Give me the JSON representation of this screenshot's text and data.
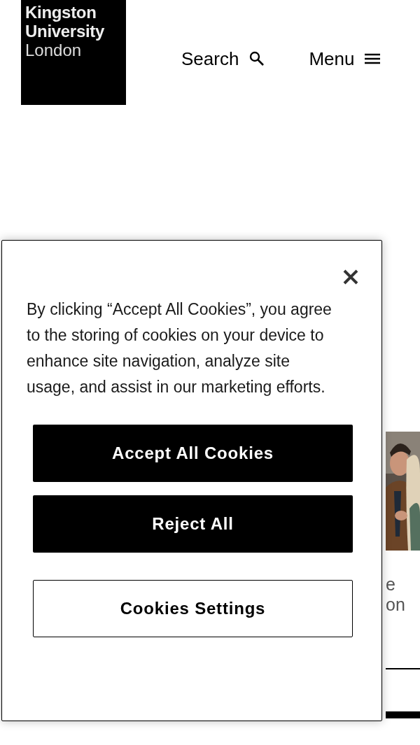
{
  "header": {
    "logo": [
      {
        "text": "Kingston",
        "kind": "bold"
      },
      {
        "text": "University",
        "kind": "bold"
      },
      {
        "text": "London",
        "kind": "light"
      }
    ],
    "search": {
      "label": "Search"
    },
    "menu": {
      "label": "Menu"
    }
  },
  "background": {
    "picture": {
      "kind": "picture"
    },
    "text": [
      "e",
      "on"
    ]
  },
  "cookie_dialog": {
    "message": "By clicking “Accept All Cookies”, you agree to the storing of cookies on your device to enhance site navigation, analyze site usage, and assist in our marketing efforts.",
    "buttons": [
      {
        "label": "Accept All Cookies",
        "kind": "primary"
      },
      {
        "label": "Reject All",
        "kind": "primary"
      },
      {
        "label": "Cookies Settings",
        "kind": "outline"
      }
    ]
  }
}
